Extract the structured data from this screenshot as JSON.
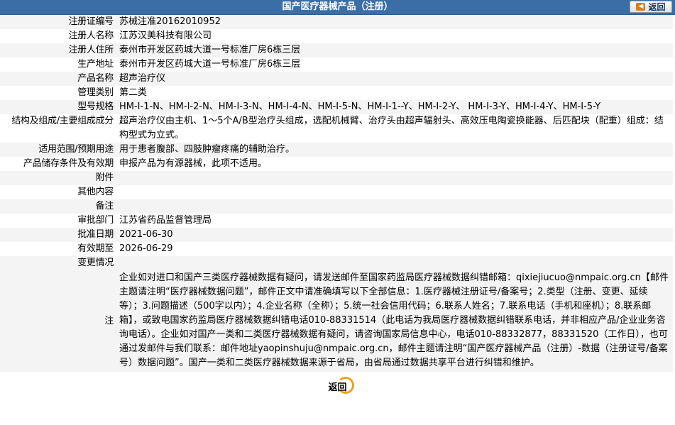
{
  "header": {
    "title": "国产医疗器械产品（注册）",
    "back_label": "返回"
  },
  "rows": [
    {
      "label": "注册证编号",
      "value": "苏械注准20162010952"
    },
    {
      "label": "注册人名称",
      "value": "江苏汉美科技有限公司"
    },
    {
      "label": "注册人住所",
      "value": "泰州市开发区药城大道一号标准厂房6栋三层"
    },
    {
      "label": "生产地址",
      "value": "泰州市开发区药城大道一号标准厂房6栋三层"
    },
    {
      "label": "产品名称",
      "value": "超声治疗仪"
    },
    {
      "label": "管理类别",
      "value": "第二类"
    },
    {
      "label": "型号规格",
      "value": "HM-I-1-N、HM-I-2-N、HM-I-3-N、HM-I-4-N、HM-I-5-N、HM-I-1--Y、HM-I-2-Y、 HM-I-3-Y、HM-I-4-Y、HM-I-5-Y"
    },
    {
      "label": "结构及组成/主要组成成分",
      "value": "超声治疗仪由主机、1～5个A/B型治疗头组成，选配机械臂、治疗头由超声辐射头、高效压电陶瓷换能器、后匹配块（配重）组成：结构型式为立式。"
    },
    {
      "label": "适用范围/预期用途",
      "value": "用于患者腹部、四肢肿瘤疼痛的辅助治疗。"
    },
    {
      "label": "产品储存条件及有效期",
      "value": "申报产品为有源器械，此项不适用。"
    },
    {
      "label": "附件",
      "value": ""
    },
    {
      "label": "其他内容",
      "value": ""
    },
    {
      "label": "备注",
      "value": ""
    },
    {
      "label": "审批部门",
      "value": "江苏省药品监督管理局"
    },
    {
      "label": "批准日期",
      "value": "2021-06-30"
    },
    {
      "label": "有效期至",
      "value": "2026-06-29"
    },
    {
      "label": "变更情况",
      "value": ""
    }
  ],
  "note": {
    "label": "注",
    "text": "企业如对进口和国产三类医疗器械数据有疑问，请发送邮件至国家药监局医疗器械数据纠错邮箱：qixiejiucuo@nmpaic.org.cn【邮件主题请注明“医疗器械数据问题”，邮件正文中请准确填写以下全部信息：1.医疗器械注册证号/备案号；2.类型（注册、变更、延续等）；3.问题描述（500字以内）；4.企业名称（全称）；5.统一社会信用代码；6.联系人姓名；7.联系电话（手机和座机）；8.联系邮箱】，或致电国家药监局医疗器械数据纠错电话010-88331514（此电话为我局医疗器械数据纠错联系电话，并非相应产品/企业业务咨询电话）。企业如对国产一类和二类医疗器械数据有疑问，请咨询国家局信息中心，电话010-88332877，88331520（工作日），也可通过发邮件与我们联系：邮件地址yaopinshuju@nmpaic.org.cn，邮件主题请注明“国产医疗器械产品（注册）-数据（注册证号/备案号）数据问题”。国产一类和二类医疗器械数据来源于省局，由省局通过数据共享平台进行纠错和维护。"
  },
  "footer": {
    "back_label": "返回"
  },
  "colors": {
    "header_bg": "#3b6ea5",
    "row_alt_bg": "#f4f4f4",
    "accent": "#f0a020"
  }
}
